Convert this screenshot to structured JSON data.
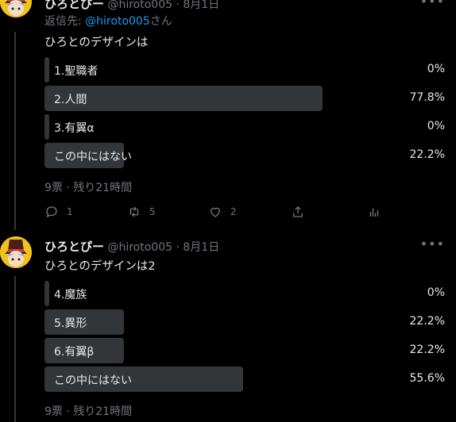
{
  "tweets": [
    {
      "display_name": "ひろとぴー",
      "handle": "@hiroto005",
      "date": "8月1日",
      "reply_prefix": "返信先: ",
      "reply_handle": "@hiroto005",
      "reply_suffix": "さん",
      "text": "ひろとのデザインは",
      "poll": [
        {
          "label": "1.聖職者",
          "pct": "0%",
          "fraction": 0.0
        },
        {
          "label": "2.人間",
          "pct": "77.8%",
          "fraction": 0.778
        },
        {
          "label": "3.有翼α",
          "pct": "0%",
          "fraction": 0.0
        },
        {
          "label": "この中にはない",
          "pct": "22.2%",
          "fraction": 0.222
        }
      ],
      "poll_footer": "9票 · 残り21時間",
      "actions": {
        "reply_count": "1",
        "retweet_count": "5",
        "like_count": "2"
      }
    },
    {
      "display_name": "ひろとぴー",
      "handle": "@hiroto005",
      "date": "8月1日",
      "text": "ひろとのデザインは2",
      "poll": [
        {
          "label": "4.魔族",
          "pct": "0%",
          "fraction": 0.0
        },
        {
          "label": "5.異形",
          "pct": "22.2%",
          "fraction": 0.222
        },
        {
          "label": "6.有翼β",
          "pct": "22.2%",
          "fraction": 0.222
        },
        {
          "label": "この中にはない",
          "pct": "55.6%",
          "fraction": 0.556
        }
      ],
      "poll_footer": "9票 · 残り21時間"
    }
  ]
}
